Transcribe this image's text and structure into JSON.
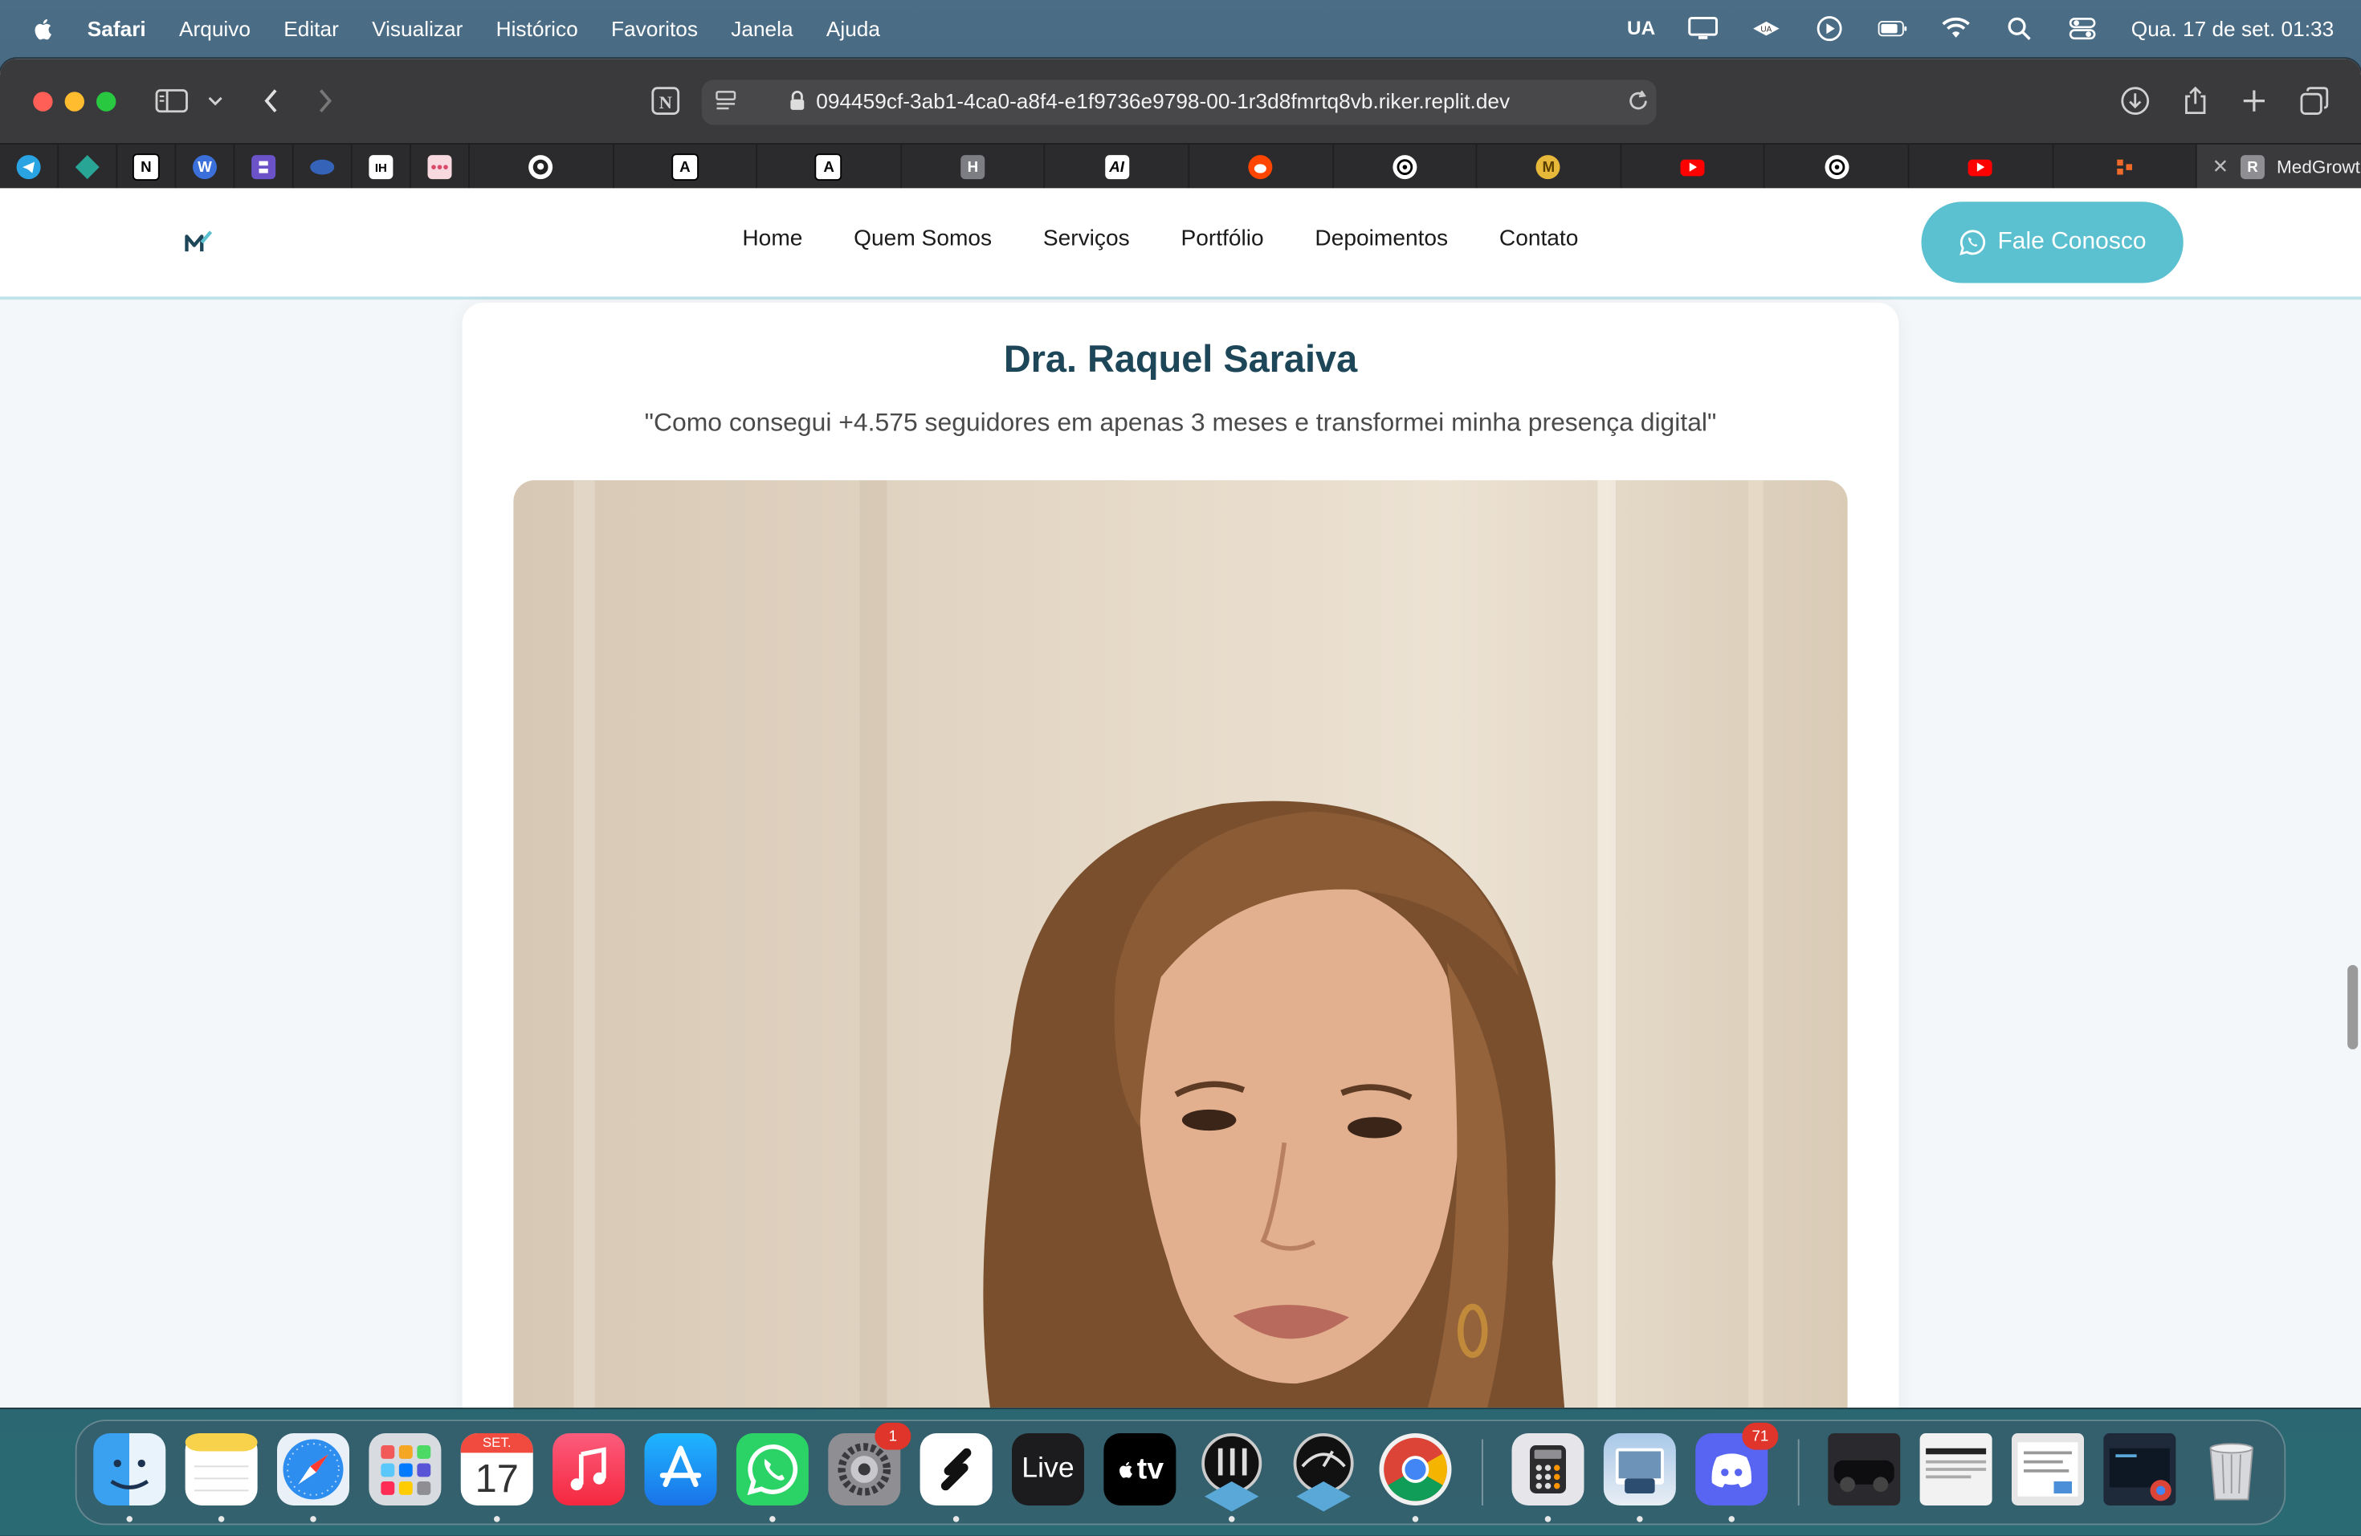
{
  "menubar": {
    "app_name": "Safari",
    "menus": [
      "Arquivo",
      "Editar",
      "Visualizar",
      "Histórico",
      "Favoritos",
      "Janela",
      "Ajuda"
    ],
    "input_source": "UA",
    "clock": "Qua. 17 de set.  01:33"
  },
  "browser": {
    "url": "094459cf-3ab1-4ca0-a8f4-e1f9736e9798-00-1r3d8fmrtq8vb.riker.replit.dev",
    "active_tab": {
      "favicon_letter": "R",
      "title": "MedGrowt..."
    },
    "tab_favicon_letters": {
      "notion": "N",
      "ih": "IH",
      "a1": "A",
      "a2": "A",
      "h": "H",
      "ai": "AI",
      "m": "M"
    }
  },
  "site": {
    "nav": [
      "Home",
      "Quem Somos",
      "Serviços",
      "Portfólio",
      "Depoimentos",
      "Contato"
    ],
    "cta_label": "Fale Conosco"
  },
  "testimonial": {
    "name": "Dra. Raquel Saraiva",
    "quote": "\"Como consegui +4.575 seguidores em apenas 3 meses e transformei minha presença digital\""
  },
  "dock": {
    "calendar_month": "SET.",
    "calendar_day": "17",
    "live_label": "Live",
    "tv_label": "tv",
    "settings_badge": "1",
    "discord_badge": "71"
  },
  "colors": {
    "accent": "#5bc0cf",
    "heading": "#1d4659",
    "nav_border": "#bfe3e9"
  }
}
